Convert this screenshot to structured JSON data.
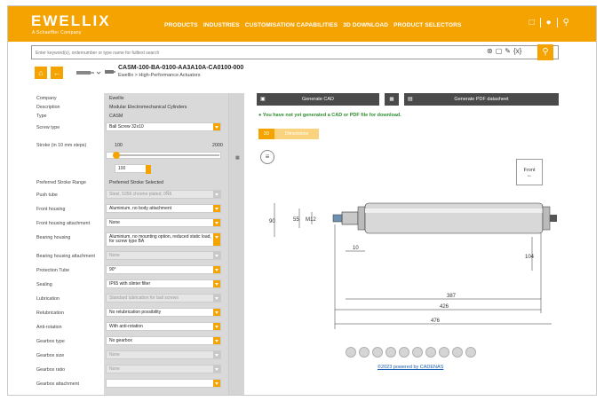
{
  "header": {
    "logo": "EWELLIX",
    "logo_sub": "A Schaeffler Company",
    "nav": [
      "PRODUCTS",
      "INDUSTRIES",
      "CUSTOMISATION CAPABILITIES",
      "3D DOWNLOAD",
      "PRODUCT SELECTORS"
    ],
    "icons": [
      "clipboard-icon",
      "user-icon",
      "search-icon"
    ]
  },
  "search": {
    "placeholder": "Enter keyword(s), ordernumber or type name for fulltext search",
    "icons": [
      "network-icon",
      "cube-icon",
      "pen-icon",
      "variable-icon"
    ]
  },
  "product": {
    "title": "CASM-100-BA-0100-AA3A10A-CA0100-000",
    "crumb_root": "Ewellix",
    "crumb_sep": ">",
    "crumb_leaf": "High-Performance Actuators"
  },
  "params": {
    "company_label": "Company",
    "company_value": "Ewellix",
    "description_label": "Description",
    "description_value": "Modular Electromechanical Cylinders",
    "type_label": "Type",
    "type_value": "CASM",
    "screw_label": "Screw type",
    "screw_value": "Ball Screw 32x10",
    "stroke_label": "Stroke (in 10 mm steps)",
    "stroke_min": "100",
    "stroke_max": "2000",
    "stroke_value": "100",
    "pref_label": "Preferred Stroke Range",
    "pref_value": "Preferred Stroke Selected",
    "push_label": "Push tube",
    "push_value": "Steel, 5356 chrome plated, 0Ñ6",
    "fh_label": "Front housing",
    "fh_value": "Aluminium, no body attachment",
    "fha_label": "Front housing attachment",
    "fha_value": "None",
    "bh_label": "Bearing housing",
    "bh_value": "Aluminium, no mounting option, reduced static load, for screw type BA",
    "bha_label": "Bearing housing attachment",
    "bha_value": "None",
    "pt_label": "Protection Tube",
    "pt_value": "90°",
    "seal_label": "Sealing",
    "seal_value": "IP65 with slinter filter",
    "lub_label": "Lubrication",
    "lub_value": "Standard lubrication for ball screws",
    "relub_label": "Relubrication",
    "relub_value": "No relubrication possibility",
    "anti_label": "Anti-rotation",
    "anti_value": "With anti-rotation",
    "gt_label": "Gearbox type",
    "gt_value": "No gearbox",
    "gs_label": "Gearbox size",
    "gs_value": "None",
    "gr_label": "Gearbox ratio",
    "gr_value": "None",
    "ga_label": "Gearbox attachment"
  },
  "actions": {
    "cad_label": "Generate CAD",
    "pdf_label": "Generate PDF datasheet",
    "status": "You have not yet generated a CAD or PDF file for download.",
    "tab_3d": "3D",
    "tab_dimensions": "Dimensions",
    "cube_face": "Front"
  },
  "drawing": {
    "dims": [
      "90",
      "55",
      "M12",
      "10",
      "104",
      "387",
      "426",
      "476"
    ]
  },
  "footer": {
    "copyright": "©2023 powered by CADENAS"
  }
}
